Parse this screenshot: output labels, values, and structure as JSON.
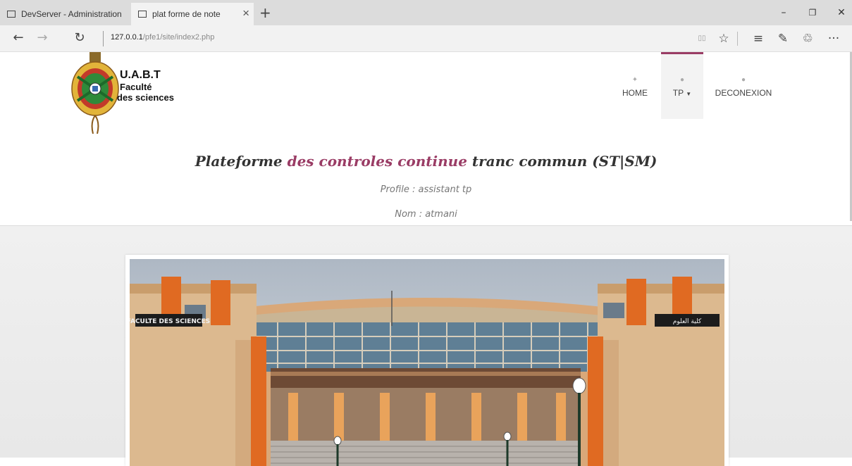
{
  "browser": {
    "tabs": [
      {
        "title": "DevServer - Administration"
      },
      {
        "title": "plat forme de note"
      }
    ],
    "tab_close": "×",
    "new_tab": "+",
    "window_controls": {
      "minimize": "–",
      "restore": "❐",
      "close": "✕"
    },
    "nav": {
      "back": "←",
      "forward": "→",
      "refresh": "↻"
    },
    "url_host": "127.0.0.1",
    "url_path": "/pfe1/site/index2.php",
    "toolbar": {
      "reading_view": "▯▯",
      "favorite": "☆",
      "hub": "≡",
      "notes": "✎",
      "share": "♲",
      "more": "···"
    }
  },
  "brand": {
    "line1": "U.A.B.T",
    "line2": "Faculté",
    "line3": "des sciences"
  },
  "nav": {
    "home_icon": "✦",
    "home": "HOME",
    "tp_icon": "●",
    "tp": "TP",
    "deco_icon": "●",
    "deco": "DECONEXION"
  },
  "headline": {
    "part1": "Plateforme ",
    "part2": "des controles continue",
    "part3": " tranc commun (ST|SM)"
  },
  "profile": "Profile : assistant tp",
  "name": "Nom : atmani",
  "photo_signs": {
    "left": "FACULTE DES SCIENCES",
    "right": "كلية العلوم"
  },
  "colors": {
    "accent": "#9a3c65"
  }
}
